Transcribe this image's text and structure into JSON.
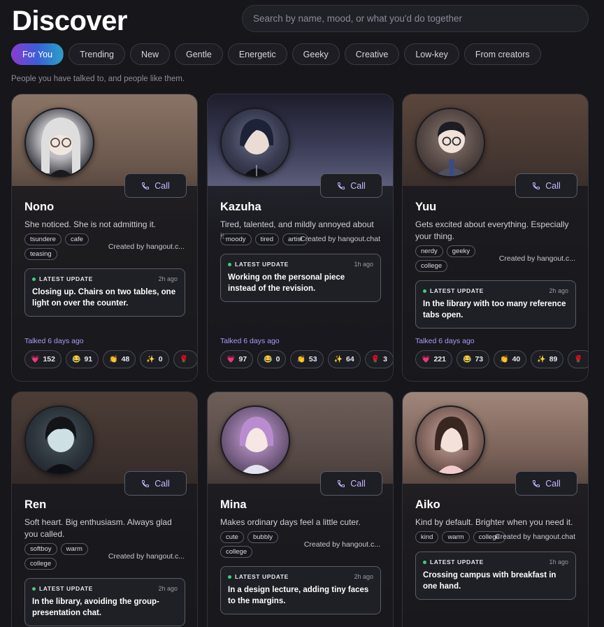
{
  "page": {
    "title": "Discover",
    "search_placeholder": "Search by name, mood, or what you'd do together",
    "subtitle": "People you have talked to, and people like them."
  },
  "tabs": [
    {
      "label": "For You",
      "active": true
    },
    {
      "label": "Trending"
    },
    {
      "label": "New"
    },
    {
      "label": "Gentle"
    },
    {
      "label": "Energetic"
    },
    {
      "label": "Geeky"
    },
    {
      "label": "Creative"
    },
    {
      "label": "Low-key"
    },
    {
      "label": "From creators"
    }
  ],
  "call_label": "Call",
  "update_label": "LATEST UPDATE",
  "cards": [
    {
      "name": "Nono",
      "description": "She noticed. She is not admitting it.",
      "tags": [
        "tsundere",
        "cafe",
        "teasing"
      ],
      "creator": "Created by hangout.c...",
      "update_time": "2h ago",
      "update_text": "Closing up. Chairs on two tables, one light on over the counter.",
      "talked": "Talked 6 days ago",
      "reactions": [
        {
          "icon": "heart-icon",
          "glyph": "💗",
          "count": "152"
        },
        {
          "icon": "grin-icon",
          "glyph": "😂",
          "count": "91"
        },
        {
          "icon": "clap-icon",
          "glyph": "👏",
          "count": "48"
        },
        {
          "icon": "sparkle-icon",
          "glyph": "✨",
          "count": "0"
        },
        {
          "icon": "rose-icon",
          "glyph": "🌹",
          "count": ""
        }
      ]
    },
    {
      "name": "Kazuha",
      "description": "Tired, talented, and mildly annoyed about it.",
      "tags": [
        "moody",
        "tired",
        "artist"
      ],
      "creator": "Created by hangout.chat",
      "update_time": "1h ago",
      "update_text": "Working on the personal piece instead of the revision.",
      "talked": "Talked 6 days ago",
      "reactions": [
        {
          "icon": "heart-icon",
          "glyph": "💗",
          "count": "97"
        },
        {
          "icon": "grin-icon",
          "glyph": "😂",
          "count": "0"
        },
        {
          "icon": "clap-icon",
          "glyph": "👏",
          "count": "53"
        },
        {
          "icon": "sparkle-icon",
          "glyph": "✨",
          "count": "64"
        },
        {
          "icon": "rose-icon",
          "glyph": "🌹",
          "count": "3"
        }
      ]
    },
    {
      "name": "Yuu",
      "description": "Gets excited about everything. Especially your thing.",
      "tags": [
        "nerdy",
        "geeky",
        "college"
      ],
      "creator": "Created by hangout.c...",
      "update_time": "2h ago",
      "update_text": "In the library with too many reference tabs open.",
      "talked": "Talked 6 days ago",
      "reactions": [
        {
          "icon": "heart-icon",
          "glyph": "💗",
          "count": "221"
        },
        {
          "icon": "grin-icon",
          "glyph": "😂",
          "count": "73"
        },
        {
          "icon": "clap-icon",
          "glyph": "👏",
          "count": "40"
        },
        {
          "icon": "sparkle-icon",
          "glyph": "✨",
          "count": "89"
        },
        {
          "icon": "rose-icon",
          "glyph": "🌹",
          "count": ""
        }
      ]
    },
    {
      "name": "Ren",
      "description": "Soft heart. Big enthusiasm. Always glad you called.",
      "tags": [
        "softboy",
        "warm",
        "college"
      ],
      "creator": "Created by hangout.c...",
      "update_time": "2h ago",
      "update_text": "In the library, avoiding the group-presentation chat."
    },
    {
      "name": "Mina",
      "description": "Makes ordinary days feel a little cuter.",
      "tags": [
        "cute",
        "bubbly",
        "college"
      ],
      "creator": "Created by hangout.c...",
      "update_time": "2h ago",
      "update_text": "In a design lecture, adding tiny faces to the margins."
    },
    {
      "name": "Aiko",
      "description": "Kind by default. Brighter when you need it.",
      "tags": [
        "kind",
        "warm",
        "college"
      ],
      "creator": "Created by hangout.chat",
      "update_time": "1h ago",
      "update_text": "Crossing campus with breakfast in one hand."
    }
  ],
  "colors": {
    "background": "#16161b",
    "accent_purple": "#a79cf7",
    "live_dot": "#3ad17a"
  }
}
